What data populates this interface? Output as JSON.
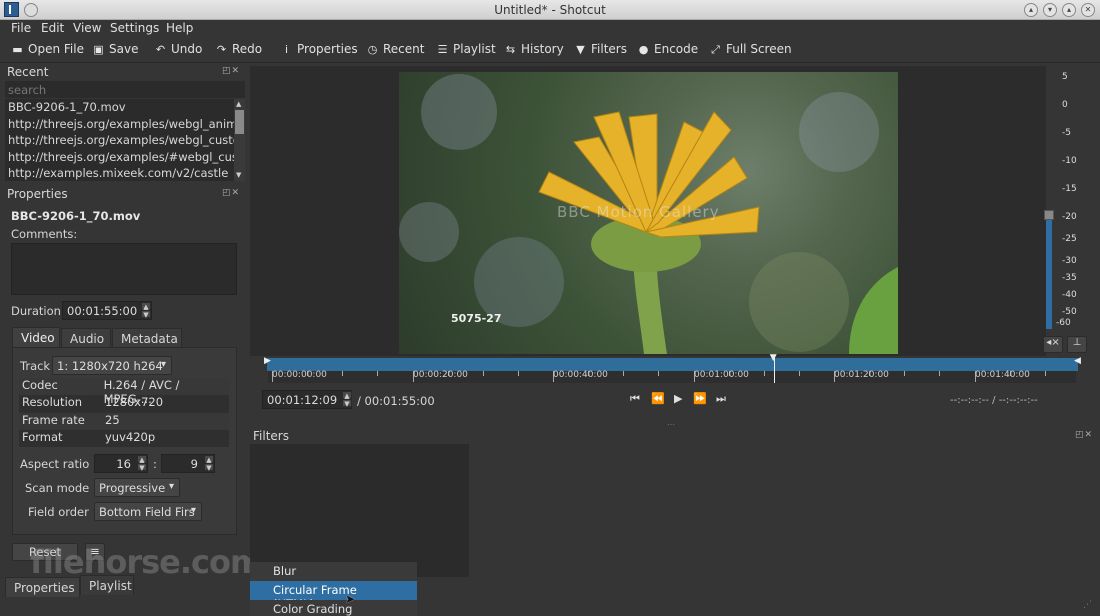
{
  "window": {
    "title": "Untitled* - Shotcut"
  },
  "menu": [
    "File",
    "Edit",
    "View",
    "Settings",
    "Help"
  ],
  "toolbar": {
    "open_file": "Open File",
    "save": "Save",
    "undo": "Undo",
    "redo": "Redo",
    "properties": "Properties",
    "recent": "Recent",
    "playlist": "Playlist",
    "history": "History",
    "filters": "Filters",
    "encode": "Encode",
    "full_screen": "Full Screen"
  },
  "recent": {
    "title": "Recent",
    "search_placeholder": "search",
    "items": [
      "BBC-9206-1_70.mov",
      "http://threejs.org/examples/webgl_anima...",
      "http://threejs.org/examples/webgl_custo...",
      "http://threejs.org/examples/#webgl_cust...",
      "http://examples.mixeek.com/v2/castle"
    ]
  },
  "properties": {
    "title": "Properties",
    "file_name": "BBC-9206-1_70.mov",
    "comments_label": "Comments:",
    "duration_label": "Duration",
    "duration_value": "00:01:55:00",
    "tabs": [
      "Video",
      "Audio",
      "Metadata"
    ],
    "track_label": "Track",
    "track_value": "1: 1280x720 h264",
    "info": [
      {
        "key": "Codec",
        "value": "H.264 / AVC / MPEG-..."
      },
      {
        "key": "Resolution",
        "value": "1280x720"
      },
      {
        "key": "Frame rate",
        "value": "25"
      },
      {
        "key": "Format",
        "value": "yuv420p"
      }
    ],
    "aspect_label": "Aspect ratio",
    "aspect_w": "16",
    "aspect_sep": ":",
    "aspect_h": "9",
    "scan_label": "Scan mode",
    "scan_value": "Progressive",
    "field_label": "Field order",
    "field_value": "Bottom Field Firs",
    "reset": "Reset",
    "menu_icon": "≡"
  },
  "bottom_tabs": [
    "Properties",
    "Playlist"
  ],
  "watermark": "filehorse.com",
  "player": {
    "overlay_logo": "BBC Motion Gallery",
    "overlay_code": "5075-27",
    "timecodes": [
      "00:00:00:00",
      "00:00:20:00",
      "00:00:40:00",
      "00:01:00:00",
      "00:01:20:00",
      "00:01:40:00"
    ],
    "position": "00:01:12:09",
    "duration": "/ 00:01:55:00",
    "in_out": "--:--:--:-- / --:--:--:--",
    "playhead_fraction": 0.626
  },
  "meter": {
    "labels": [
      "5",
      "0",
      "-5",
      "-10",
      "-15",
      "-20",
      "-25",
      "-30",
      "-35",
      "-40",
      "-50",
      "-60"
    ]
  },
  "filters": {
    "title": "Filters",
    "menu": [
      "Blur",
      "Circular Frame (HTML)",
      "Color Grading"
    ],
    "selected": "Circular Frame (HTML)"
  },
  "colors": {
    "accent": "#2f6ea3",
    "timeline": "#2f6d9a",
    "bg": "#353535"
  }
}
